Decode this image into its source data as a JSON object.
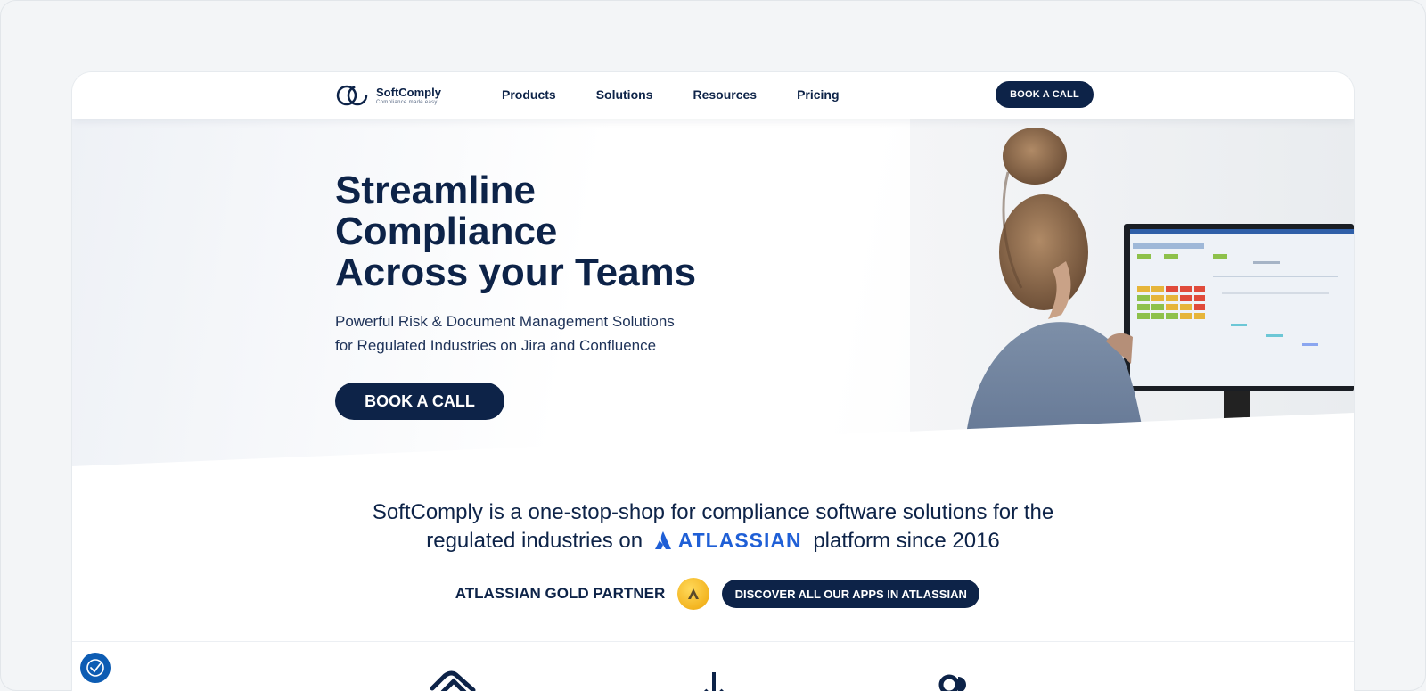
{
  "header": {
    "logo_name": "SoftComply",
    "logo_tagline": "Compliance made easy",
    "nav": [
      "Products",
      "Solutions",
      "Resources",
      "Pricing"
    ],
    "cta": "BOOK A CALL"
  },
  "hero": {
    "title_lines": [
      "Streamline",
      "Compliance",
      "Across your Teams"
    ],
    "subtitle_lines": [
      "Powerful Risk & Document Management Solutions",
      "for Regulated Industries on Jira and Confluence"
    ],
    "cta": "BOOK A CALL"
  },
  "intro": {
    "line1": "SoftComply is a one-stop-shop for compliance software solutions for the",
    "line2_before": "regulated industries on",
    "atlassian_wordmark": "ATLASSIAN",
    "line2_after": "platform since 2016",
    "partner_label": "ATLASSIAN GOLD PARTNER",
    "apps_button": "DISCOVER ALL OUR APPS IN ATLASSIAN"
  },
  "colors": {
    "navy": "#0d2348",
    "atlassian_blue": "#1f5fd6",
    "gold": "#f3b420",
    "accessibility_blue": "#0d5cb3"
  },
  "icons": [
    "softcomply-logo-icon",
    "atlassian-icon",
    "gold-partner-badge-icon",
    "handshake-icon",
    "anchor-icon",
    "toggle-icon",
    "accessibility-icon"
  ]
}
